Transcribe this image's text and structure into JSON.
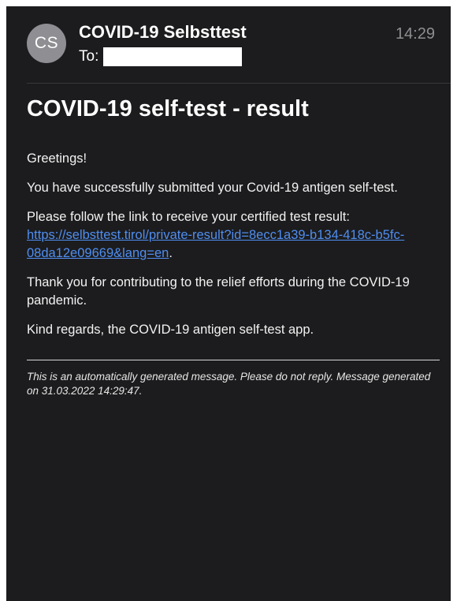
{
  "header": {
    "avatar_initials": "CS",
    "sender_name": "COVID-19 Selbsttest",
    "to_label": "To:",
    "time": "14:29"
  },
  "email": {
    "title": "COVID-19 self-test - result",
    "greeting": "Greetings!",
    "submitted_text": "You have successfully submitted your Covid-19 antigen self-test.",
    "link_intro": "Please follow the link to receive your certified test result:",
    "link_text": "https://selbsttest.tirol/private-result?id=8ecc1a39-b134-418c-b5fc-08da12e09669&lang=en",
    "link_suffix": ".",
    "thanks_text": "Thank you for contributing to the relief efforts during the COVID-19 pandemic.",
    "regards_text": "Kind regards, the COVID-19 antigen self-test app.",
    "footer_text": "This is an automatically generated message. Please do not reply. Message generated on 31.03.2022 14:29:47."
  },
  "colors": {
    "background": "#1c1c1e",
    "avatar": "#8e8e93",
    "link": "#4f8ef0"
  }
}
